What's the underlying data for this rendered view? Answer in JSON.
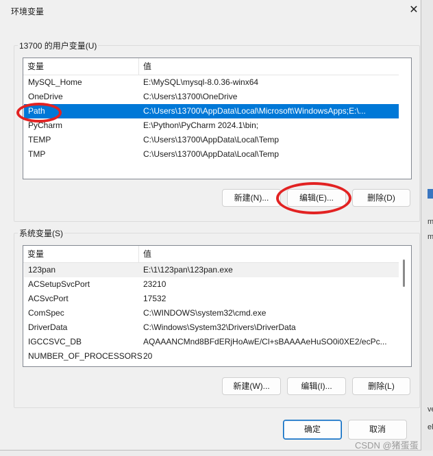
{
  "window": {
    "title": "环境变量",
    "close_glyph": "✕"
  },
  "user_vars": {
    "group_label": "13700 的用户变量(U)",
    "col_name": "变量",
    "col_value": "值",
    "rows": [
      {
        "name": "MySQL_Home",
        "value": "E:\\MySQL\\mysql-8.0.36-winx64"
      },
      {
        "name": "OneDrive",
        "value": "C:\\Users\\13700\\OneDrive"
      },
      {
        "name": "Path",
        "value": "C:\\Users\\13700\\AppData\\Local\\Microsoft\\WindowsApps;E:\\...",
        "selected": true
      },
      {
        "name": "PyCharm",
        "value": "E:\\Python\\PyCharm 2024.1\\bin;"
      },
      {
        "name": "TEMP",
        "value": "C:\\Users\\13700\\AppData\\Local\\Temp"
      },
      {
        "name": "TMP",
        "value": "C:\\Users\\13700\\AppData\\Local\\Temp"
      }
    ],
    "new_button": "新建(N)...",
    "edit_button": "编辑(E)...",
    "delete_button": "删除(D)"
  },
  "system_vars": {
    "group_label": "系统变量(S)",
    "col_name": "变量",
    "col_value": "值",
    "rows": [
      {
        "name": "123pan",
        "value": "E:\\1\\123pan\\123pan.exe",
        "highlight": true
      },
      {
        "name": "ACSetupSvcPort",
        "value": "23210"
      },
      {
        "name": "ACSvcPort",
        "value": "17532"
      },
      {
        "name": "ComSpec",
        "value": "C:\\WINDOWS\\system32\\cmd.exe"
      },
      {
        "name": "DriverData",
        "value": "C:\\Windows\\System32\\Drivers\\DriverData"
      },
      {
        "name": "IGCCSVC_DB",
        "value": "AQAAANCMnd8BFdERjHoAwE/Cl+sBAAAAeHuSO0i0XE2/ecPc..."
      },
      {
        "name": "NUMBER_OF_PROCESSORS",
        "value": "20"
      }
    ],
    "new_button": "新建(W)...",
    "edit_button": "编辑(I)...",
    "delete_button": "删除(L)"
  },
  "footer": {
    "ok_button": "确定",
    "cancel_button": "取消"
  },
  "background": {
    "side_chars": [
      "m",
      "m",
      "ve",
      "el"
    ]
  },
  "watermark": "CSDN @猪蛋蛋",
  "colors": {
    "selection": "#0078d7",
    "annotation": "#e22222",
    "primary_border": "#0067c0"
  }
}
